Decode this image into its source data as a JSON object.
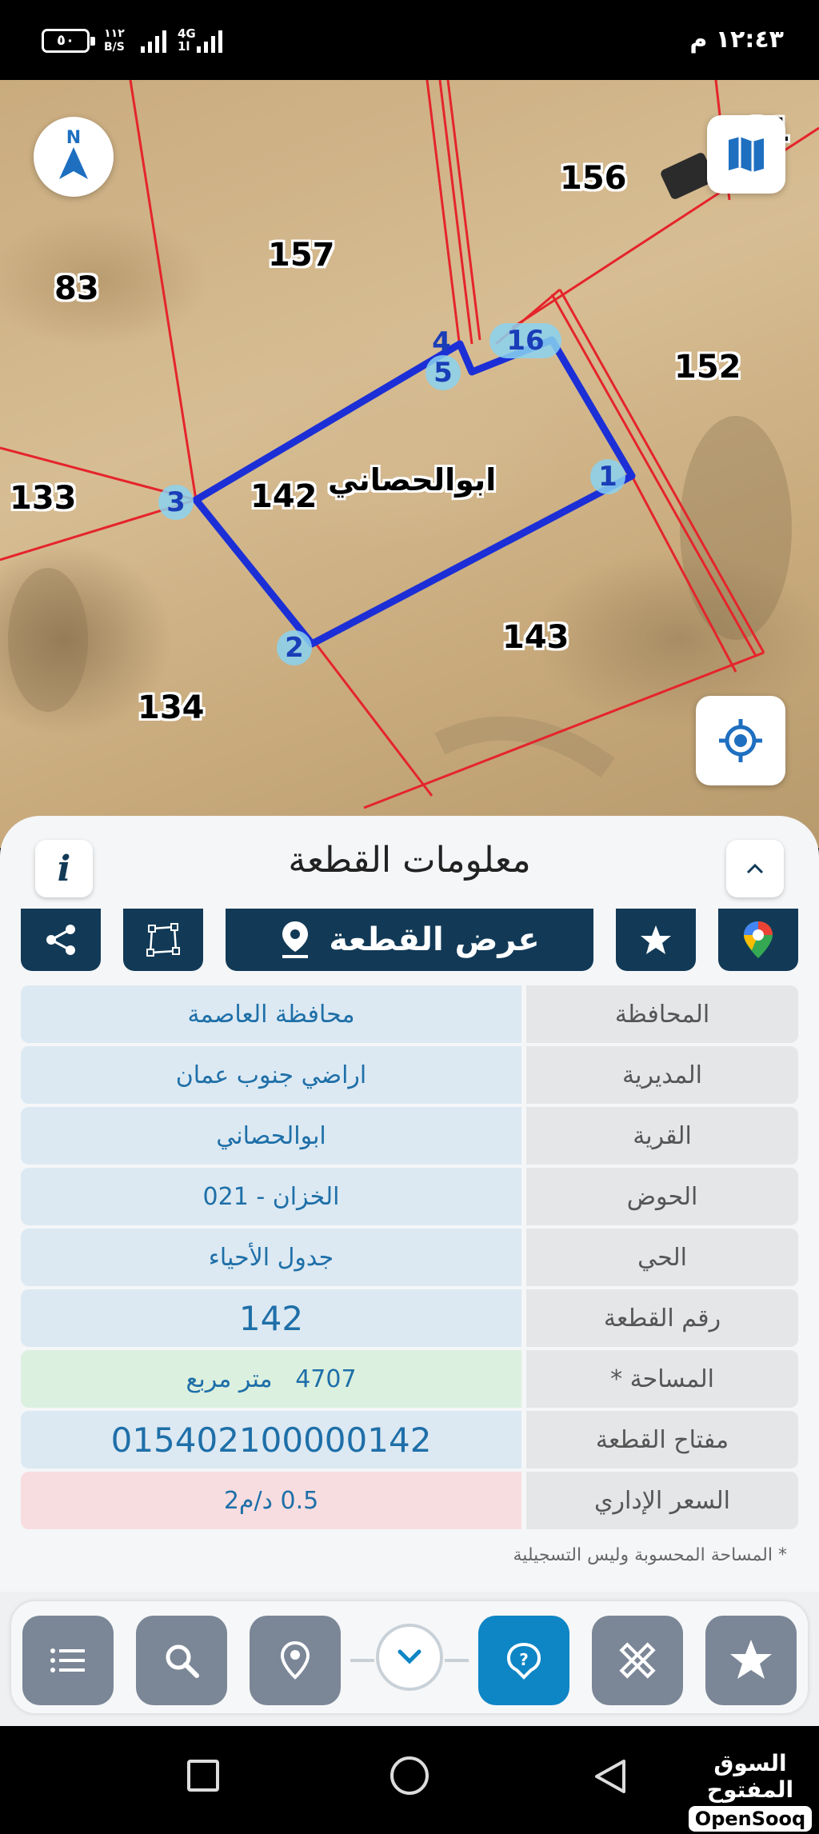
{
  "status_bar": {
    "battery": "٥٠",
    "speed_value": "١١٢",
    "speed_unit": "B/S",
    "network": "4G",
    "network_sub": "1l",
    "time": "١٢:٤٣ م"
  },
  "map": {
    "parcels": [
      "156",
      "157",
      "83",
      "152",
      "133",
      "142",
      "143",
      "134",
      "81"
    ],
    "village_label": "ابوالحصاني",
    "vertices": [
      "4",
      "5",
      "16",
      "1",
      "3",
      "2"
    ],
    "north_label": "N"
  },
  "panel": {
    "title": "معلومات القطعة",
    "info_label": "i",
    "show_parcel_label": "عرض القطعة",
    "rows": [
      {
        "label": "المحافظة",
        "value": "محافظة العاصمة"
      },
      {
        "label": "المديرية",
        "value": "اراضي جنوب عمان"
      },
      {
        "label": "القرية",
        "value": "ابوالحصاني"
      },
      {
        "label": "الحوض",
        "value": "الخزان - 021"
      },
      {
        "label": "الحي",
        "value": "جدول الأحياء"
      },
      {
        "label": "رقم القطعة",
        "value": "142"
      },
      {
        "label": "المساحة *",
        "value": "4707   متر مربع"
      },
      {
        "label": "مفتاح القطعة",
        "value": "015402100000142"
      },
      {
        "label": "السعر الإداري",
        "value": "0.5 د/م2"
      }
    ],
    "footnote": "* المساحة المحسوبة وليس التسجيلية"
  },
  "brand": {
    "arabic": "السوق المفتوح",
    "english": "OpenSooq"
  },
  "colors": {
    "boundary_red": "#e5242b",
    "parcel_blue": "#1c2fd6",
    "action_navy": "#123a57",
    "active_blue": "#0e85c5",
    "tool_gray": "#7b8797"
  }
}
